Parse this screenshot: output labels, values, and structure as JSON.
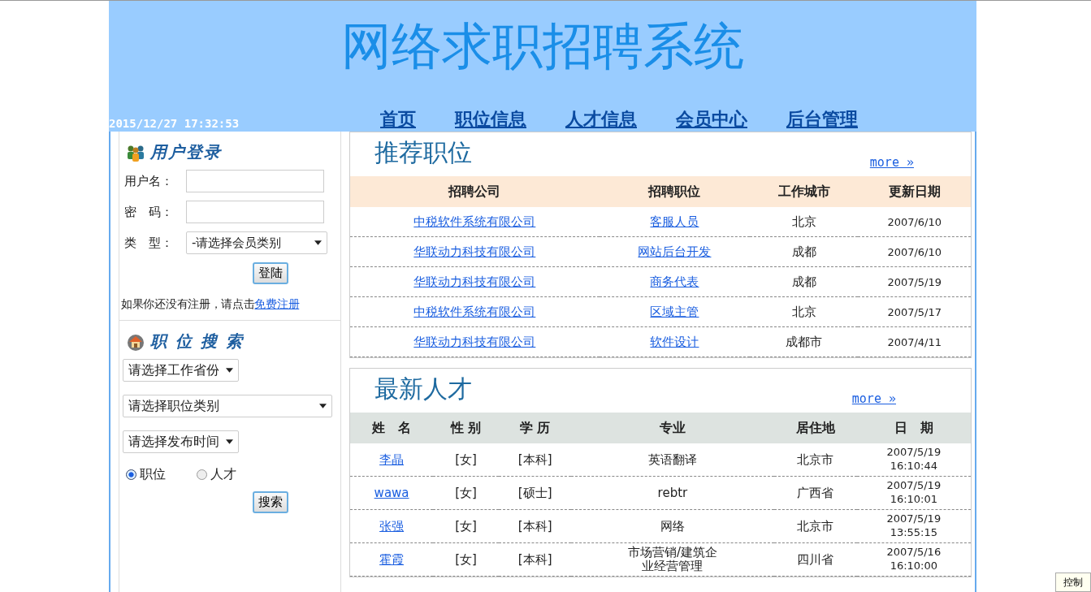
{
  "header": {
    "title": "网络求职招聘系统",
    "datetime": "2015/12/27 17:32:53",
    "nav": [
      "首页",
      "职位信息",
      "人才信息",
      "会员中心",
      "后台管理"
    ]
  },
  "login": {
    "title": "用户登录",
    "fields": [
      {
        "label": "用户名：",
        "kind": "text"
      },
      {
        "label": "密　码：",
        "kind": "password"
      },
      {
        "label": "类　型：",
        "kind": "select",
        "value": "-请选择会员类别"
      }
    ],
    "button": "登陆",
    "note": "如果你还没有注册，请点击",
    "register_link": "免费注册"
  },
  "search": {
    "title": "职 位 搜 索",
    "selects": [
      {
        "value": "请选择工作省份",
        "wide": false
      },
      {
        "value": "请选择职位类别",
        "wide": true
      },
      {
        "value": "请选择发布时间",
        "wide": false
      }
    ],
    "radios": [
      {
        "label": "职位",
        "selected": true
      },
      {
        "label": "人才",
        "selected": false
      }
    ],
    "button": "搜索"
  },
  "jobs": {
    "title": "推荐职位",
    "more": "more »",
    "columns": [
      "招聘公司",
      "招聘职位",
      "工作城市",
      "更新日期"
    ],
    "rows": [
      {
        "company": "中税软件系统有限公司",
        "position": "客服人员",
        "city": "北京",
        "date": "2007/6/10"
      },
      {
        "company": "华联动力科技有限公司",
        "position": "网站后台开发",
        "city": "成都",
        "date": "2007/6/10"
      },
      {
        "company": "华联动力科技有限公司",
        "position": "商务代表",
        "city": "成都",
        "date": "2007/5/19"
      },
      {
        "company": "中税软件系统有限公司",
        "position": "区域主管",
        "city": "北京",
        "date": "2007/5/17"
      },
      {
        "company": "华联动力科技有限公司",
        "position": "软件设计",
        "city": "成都市",
        "date": "2007/4/11"
      }
    ]
  },
  "talents": {
    "title": "最新人才",
    "more": "more »",
    "columns": [
      "姓　名",
      "性 别",
      "学 历",
      "专业",
      "居住地",
      "日　期"
    ],
    "rows": [
      {
        "name": "李晶",
        "gender": "[女]",
        "education": "[本科]",
        "major": "英语翻译",
        "residence": "北京市",
        "date": "2007/5/19",
        "time": "16:10:44"
      },
      {
        "name": "wawa",
        "gender": "[女]",
        "education": "[硕士]",
        "major": "rebtr",
        "residence": "广西省",
        "date": "2007/5/19",
        "time": "16:10:01"
      },
      {
        "name": "张强",
        "gender": "[女]",
        "education": "[本科]",
        "major": "网络",
        "residence": "北京市",
        "date": "2007/5/19",
        "time": "13:55:15"
      },
      {
        "name": "霍霞",
        "gender": "[女]",
        "education": "[本科]",
        "major": "市场营销/建筑企业经营管理",
        "residence": "四川省",
        "date": "2007/5/16",
        "time": "16:10:00"
      }
    ]
  },
  "control_button": "控制"
}
